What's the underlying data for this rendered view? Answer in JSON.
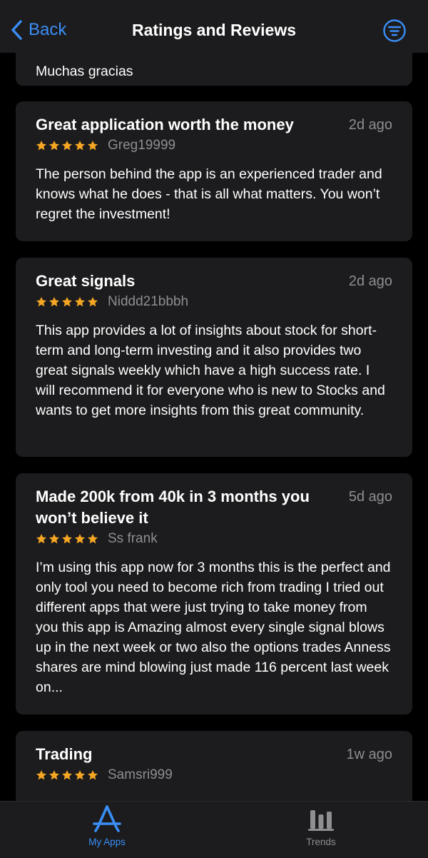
{
  "nav": {
    "back_label": "Back",
    "title": "Ratings and Reviews",
    "icons": {
      "back": "chevron-left-icon",
      "filter": "filter-icon"
    }
  },
  "colors": {
    "background": "#000000",
    "card": "#1c1c1e",
    "accent": "#3a8ef6",
    "star": "#f5a623",
    "secondary_text": "#8e8e93"
  },
  "reviews": [
    {
      "title": "",
      "date": "",
      "author": "",
      "stars": 5,
      "body": "Muchas gracias"
    },
    {
      "title": "Great application worth the money",
      "date": "2d ago",
      "author": "Greg19999",
      "stars": 5,
      "body": "The person behind the app is an experienced trader and knows what he does - that is all what matters. You won’t regret the investment!"
    },
    {
      "title": "Great signals",
      "date": "2d ago",
      "author": "Niddd21bbbh",
      "stars": 5,
      "body": "This app provides a lot of insights about stock for short-term and long-term investing and it also provides two great signals weekly which have a high success rate. I will recommend it for everyone who is new to Stocks and wants to get more insights from this great community."
    },
    {
      "title": "Made 200k from 40k in 3 months you won’t believe it",
      "date": "5d ago",
      "author": "Ss frank",
      "stars": 5,
      "body": "I’m using this app now for 3 months this is the perfect and only tool you need to become rich from trading I tried out different apps that were just trying to take money from you this app is Amazing almost every single signal blows up in the next week or two also the options trades Anness shares are mind blowing just made 116 percent last week on..."
    },
    {
      "title": "Trading",
      "date": "1w ago",
      "author": "Samsri999",
      "stars": 5,
      "body": ""
    }
  ],
  "tabbar": {
    "tabs": [
      {
        "label": "My Apps",
        "icon": "app-store-icon",
        "selected": true
      },
      {
        "label": "Trends",
        "icon": "trends-icon",
        "selected": false
      }
    ]
  }
}
